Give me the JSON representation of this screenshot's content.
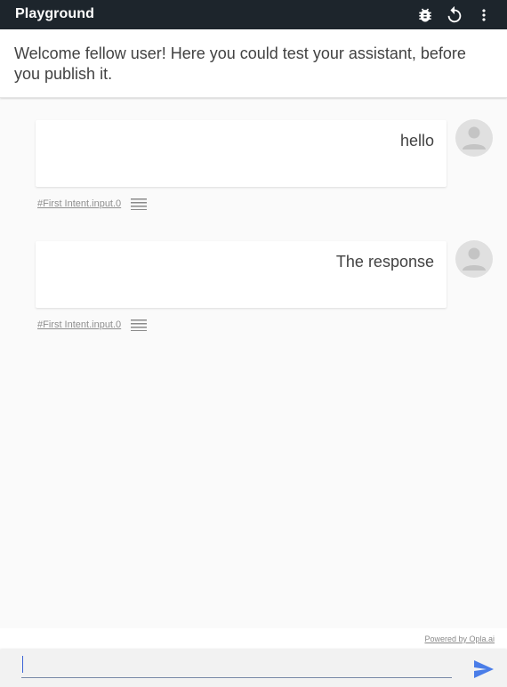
{
  "header": {
    "title": "Playground",
    "icons": [
      "bug-icon",
      "refresh-icon",
      "more-vert-icon"
    ]
  },
  "welcome": {
    "text": "Welcome fellow user! Here you could test your assistant, before you publish it."
  },
  "messages": [
    {
      "text": "hello",
      "intent": "#First Intent.input.0"
    },
    {
      "text": "The response",
      "intent": "#First Intent.input.0"
    }
  ],
  "footer": {
    "powered_by": "Powered by Opla.ai"
  },
  "composer": {
    "value": "",
    "placeholder": ""
  },
  "colors": {
    "header_bg": "#1d252c",
    "accent": "#3b63d6",
    "background": "#fafafa"
  }
}
